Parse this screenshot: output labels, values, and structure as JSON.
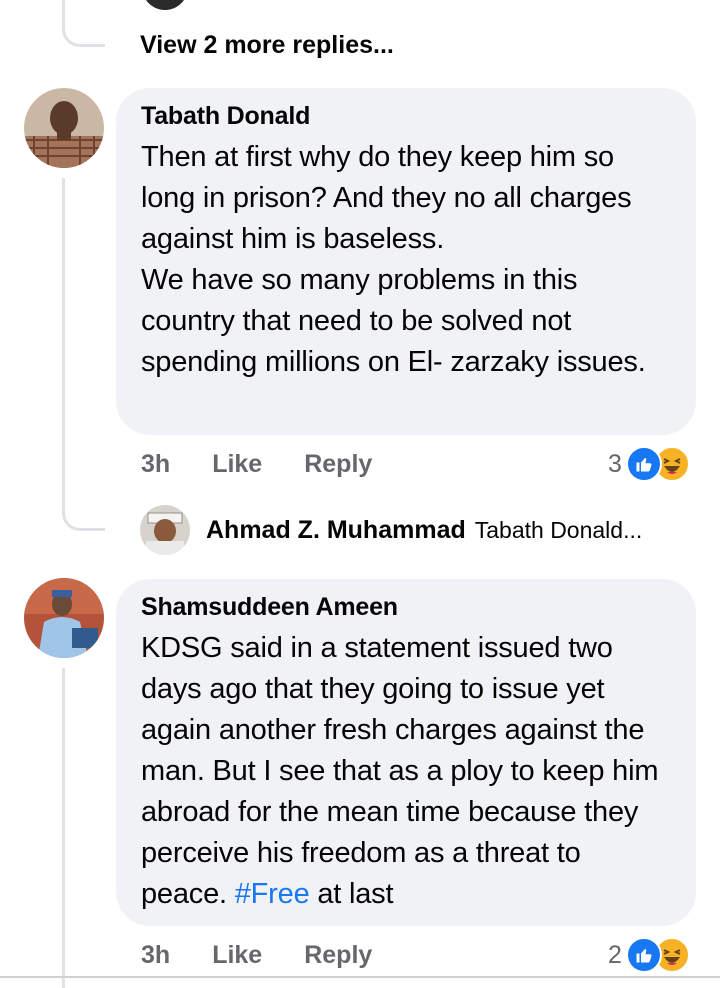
{
  "top": {
    "view_more_replies": "View 2 more replies..."
  },
  "comments": [
    {
      "author": "Tabath Donald",
      "text": "Then at first why do they keep him so long in prison? And they no all charges against him is baseless.\nWe have so many problems in this country that need to be solved not spending millions on El- zarzaky issues.",
      "time": "3h",
      "like_label": "Like",
      "reply_label": "Reply",
      "reaction_count": "3",
      "reactions": [
        "like-icon",
        "haha-icon"
      ],
      "reply_preview": {
        "author": "Ahmad Z. Muhammad",
        "snippet": "Tabath Donald..."
      }
    },
    {
      "author": "Shamsuddeen Ameen",
      "text_before_hashtag": "KDSG said in a statement issued two days ago that they going to issue yet again another fresh charges against the man. But I see that as a ploy to keep him abroad for the mean time because they perceive his freedom as a threat to peace. ",
      "hashtag": "#Free",
      "text_after_hashtag": " at last",
      "time": "3h",
      "like_label": "Like",
      "reply_label": "Reply",
      "reaction_count": "2",
      "reactions": [
        "like-icon",
        "haha-icon"
      ]
    }
  ],
  "colors": {
    "bubble": "#f0f2f5",
    "secondary_text": "#65676b",
    "like_blue": "#1877f2",
    "haha_yellow": "#f7b125",
    "thread_line": "#dfe1e5"
  }
}
